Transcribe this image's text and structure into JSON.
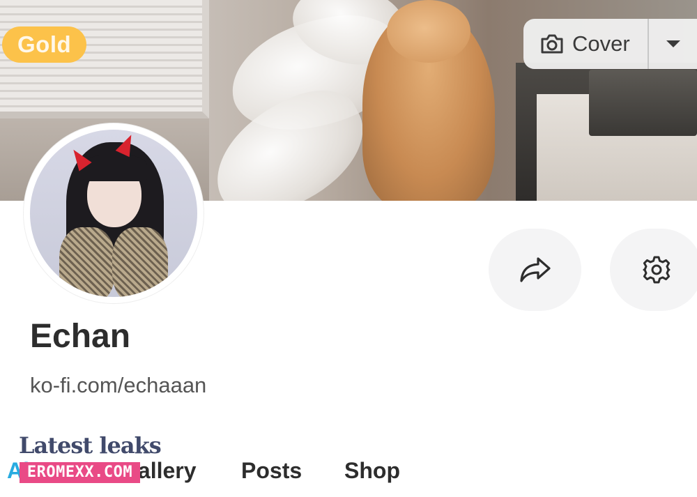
{
  "cover": {
    "badge": "Gold",
    "cover_button_label": "Cover"
  },
  "profile": {
    "name": "Echan",
    "link": "ko-fi.com/echaaan"
  },
  "actions": {
    "share_icon": "share-arrow-icon",
    "settings_icon": "gear-icon"
  },
  "tabs": [
    {
      "label": "About",
      "active": true
    },
    {
      "label": "Gallery",
      "active": false
    },
    {
      "label": "Posts",
      "active": false
    },
    {
      "label": "Shop",
      "active": false
    }
  ],
  "watermark": {
    "title": "Latest leaks",
    "badge": "EROMEXX.COM"
  },
  "colors": {
    "gold_badge": "#fcc24a",
    "active_tab": "#29abe0",
    "watermark_badge": "#e94a86"
  }
}
